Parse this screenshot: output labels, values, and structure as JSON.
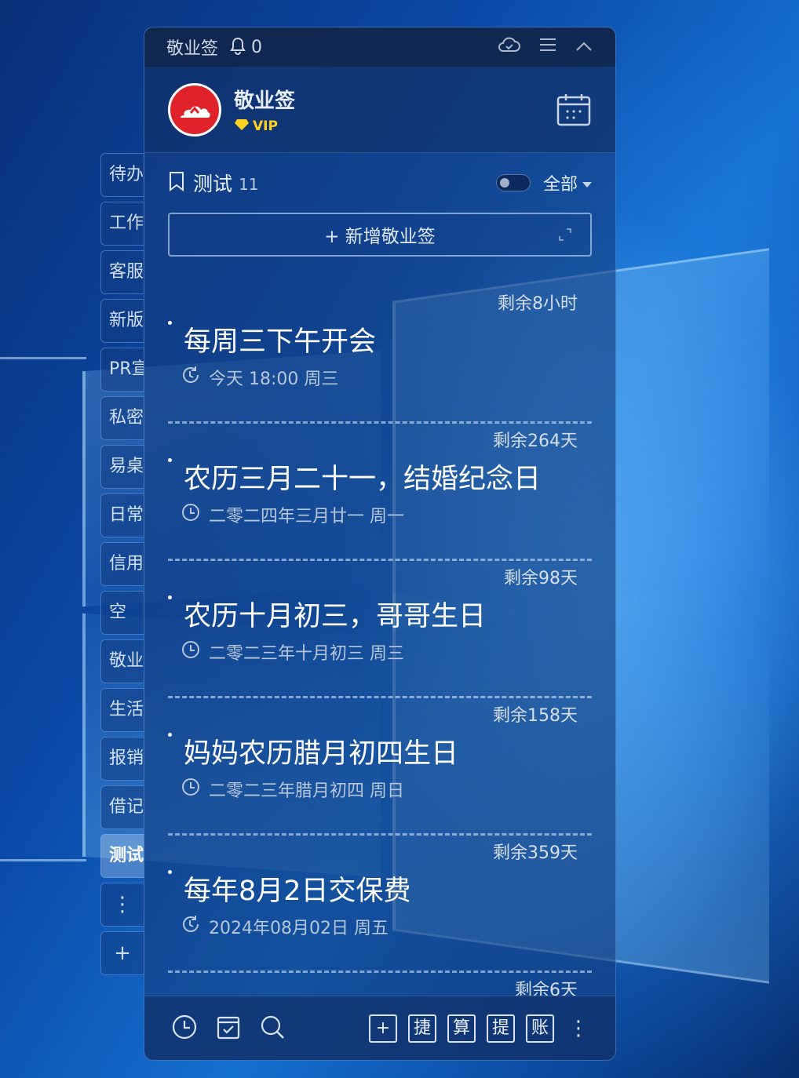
{
  "categories": [
    {
      "label": "待办"
    },
    {
      "label": "工作"
    },
    {
      "label": "客服"
    },
    {
      "label": "新版"
    },
    {
      "label": "PR宣"
    },
    {
      "label": "私密"
    },
    {
      "label": "易桌"
    },
    {
      "label": "日常"
    },
    {
      "label": "信用"
    },
    {
      "label": "空"
    },
    {
      "label": "敬业"
    },
    {
      "label": "生活"
    },
    {
      "label": "报销"
    },
    {
      "label": "借记"
    },
    {
      "label": "测试"
    }
  ],
  "category_tools": {
    "more": "⋮",
    "add": "+"
  },
  "titlebar": {
    "app_name": "敬业签",
    "bell_count": "0"
  },
  "profile": {
    "name": "敬业签",
    "vip": "VIP"
  },
  "list": {
    "title": "测试",
    "count": "11",
    "filter": "全部"
  },
  "add_button": {
    "label": "+ 新增敬业签"
  },
  "items": [
    {
      "remain": "剩余8小时",
      "title": "每周三下午开会",
      "date": "今天 18:00 周三",
      "icon": "repeat-clock-icon"
    },
    {
      "remain": "剩余264天",
      "title": "农历三月二十一，结婚纪念日",
      "date": "二零二四年三月廿一 周一",
      "icon": "clock-icon"
    },
    {
      "remain": "剩余98天",
      "title": "农历十月初三，哥哥生日",
      "date": "二零二三年十月初三 周三",
      "icon": "clock-icon"
    },
    {
      "remain": "剩余158天",
      "title": "妈妈农历腊月初四生日",
      "date": "二零二三年腊月初四 周日",
      "icon": "clock-icon"
    },
    {
      "remain": "剩余359天",
      "title": "每年8月2日交保费",
      "date": "2024年08月02日 周五",
      "icon": "repeat-clock-icon"
    },
    {
      "remain": "剩余6天"
    }
  ],
  "footer": {
    "buttons": [
      "+",
      "捷",
      "算",
      "提",
      "账"
    ],
    "more": "⋮"
  }
}
